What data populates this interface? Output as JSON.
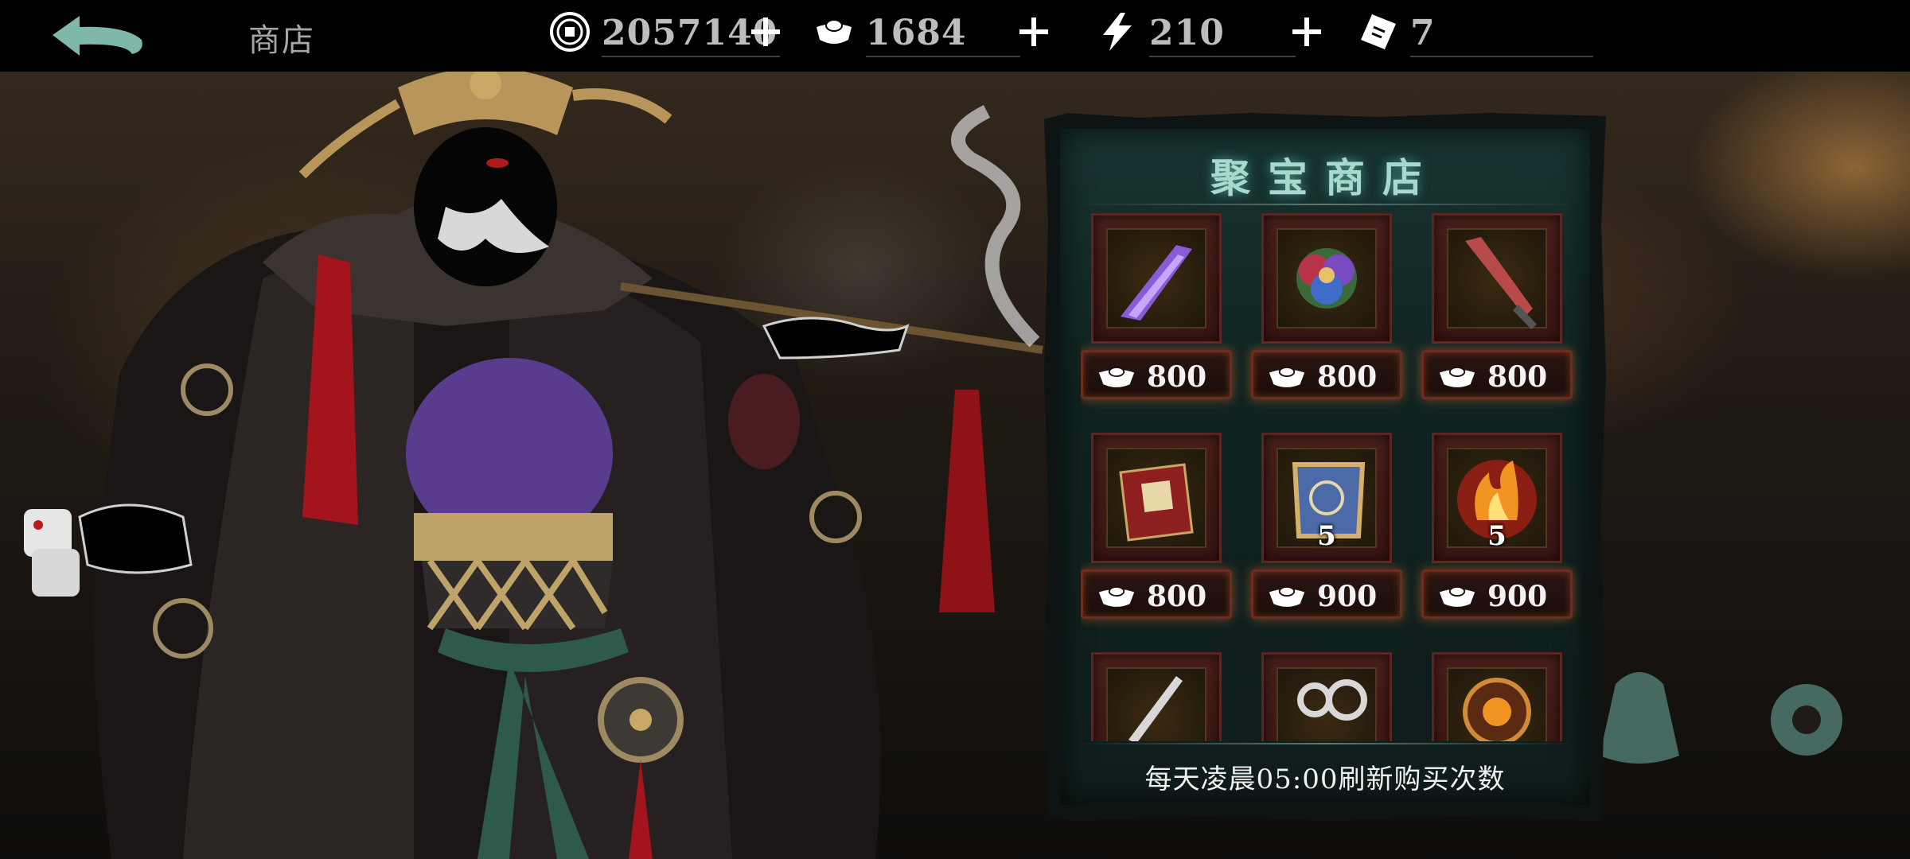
{
  "header": {
    "title": "商店",
    "resources": [
      {
        "name": "coins",
        "value": "2057140"
      },
      {
        "name": "silver-ingot",
        "value": "1684"
      },
      {
        "name": "energy",
        "value": "210"
      },
      {
        "name": "ticket",
        "value": "7"
      }
    ]
  },
  "shop": {
    "title": "聚宝商店",
    "refresh_note": "每天凌晨05:00刷新购买次数",
    "items": [
      {
        "icon": "purple-crystal-icon",
        "price": "800",
        "qty": ""
      },
      {
        "icon": "flower-icon",
        "price": "800",
        "qty": ""
      },
      {
        "icon": "red-sword-icon",
        "price": "800",
        "qty": ""
      },
      {
        "icon": "red-book-icon",
        "price": "800",
        "qty": ""
      },
      {
        "icon": "scroll-icon",
        "price": "900",
        "qty": "5"
      },
      {
        "icon": "fire-orb-icon",
        "price": "900",
        "qty": "5"
      },
      {
        "icon": "blade-icon",
        "price": "",
        "qty": ""
      },
      {
        "icon": "shackle-icon",
        "price": "",
        "qty": ""
      },
      {
        "icon": "bagua-icon",
        "price": "",
        "qty": ""
      }
    ]
  },
  "colors": {
    "accent_teal": "#a9d8cd",
    "price_border": "#6b2d1f",
    "panel_bg": "#102321"
  }
}
